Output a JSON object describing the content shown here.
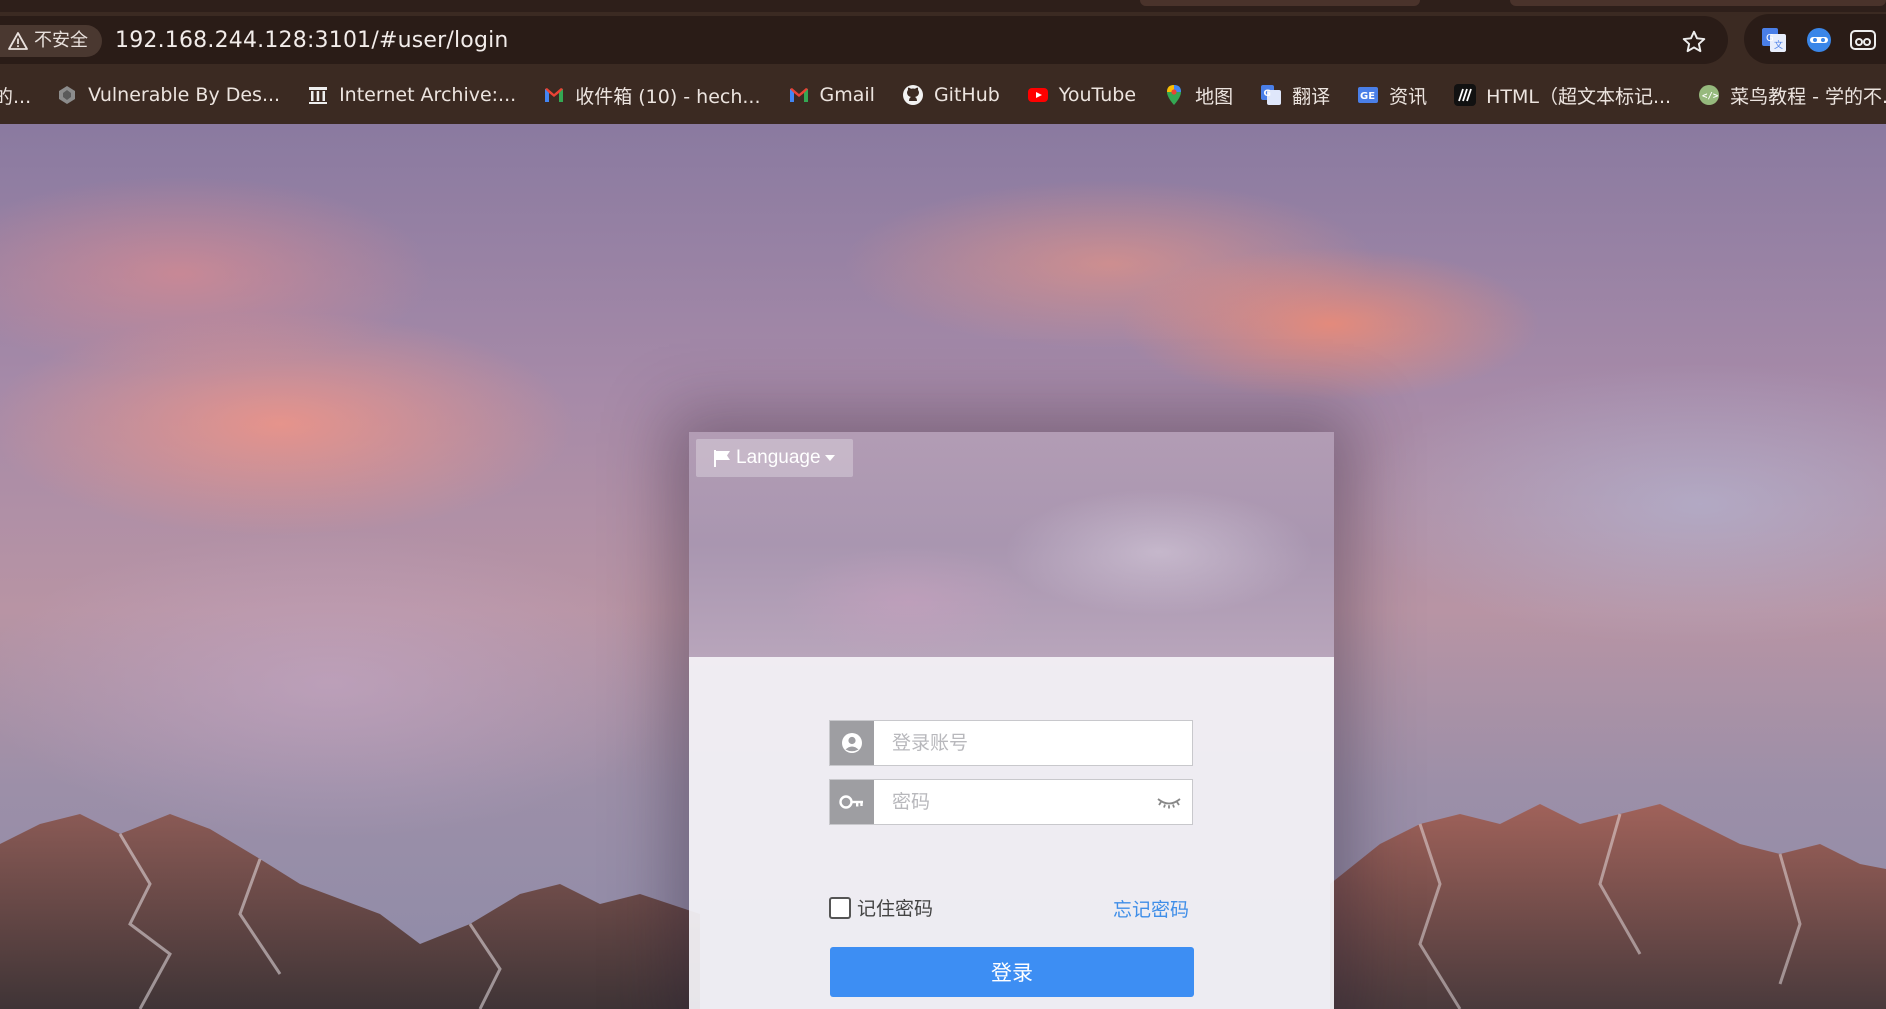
{
  "browser": {
    "security_label": "不安全",
    "url": "192.168.244.128:3101/#user/login",
    "bookmarks": [
      {
        "label": "的...",
        "icon": "truncated-icon"
      },
      {
        "label": "Vulnerable By Des...",
        "icon": "vulnhub-icon"
      },
      {
        "label": "Internet Archive:...",
        "icon": "archive-icon"
      },
      {
        "label": "收件箱 (10) - hech...",
        "icon": "gmail-icon"
      },
      {
        "label": "Gmail",
        "icon": "gmail-icon"
      },
      {
        "label": "GitHub",
        "icon": "github-icon"
      },
      {
        "label": "YouTube",
        "icon": "youtube-icon"
      },
      {
        "label": "地图",
        "icon": "maps-icon"
      },
      {
        "label": "翻译",
        "icon": "translate-icon"
      },
      {
        "label": "资讯",
        "icon": "news-icon"
      },
      {
        "label": "HTML（超文本标记...",
        "icon": "mdn-icon"
      },
      {
        "label": "菜鸟教程 - 学的不...",
        "icon": "runoob-icon"
      }
    ]
  },
  "login": {
    "language_label": "Language",
    "account_placeholder": "登录账号",
    "password_placeholder": "密码",
    "remember_label": "记住密码",
    "forgot_label": "忘记密码",
    "submit_label": "登录"
  },
  "colors": {
    "accent": "#3d8ef3",
    "link": "#3f8ee8",
    "browser_bg": "#3b2a22"
  }
}
